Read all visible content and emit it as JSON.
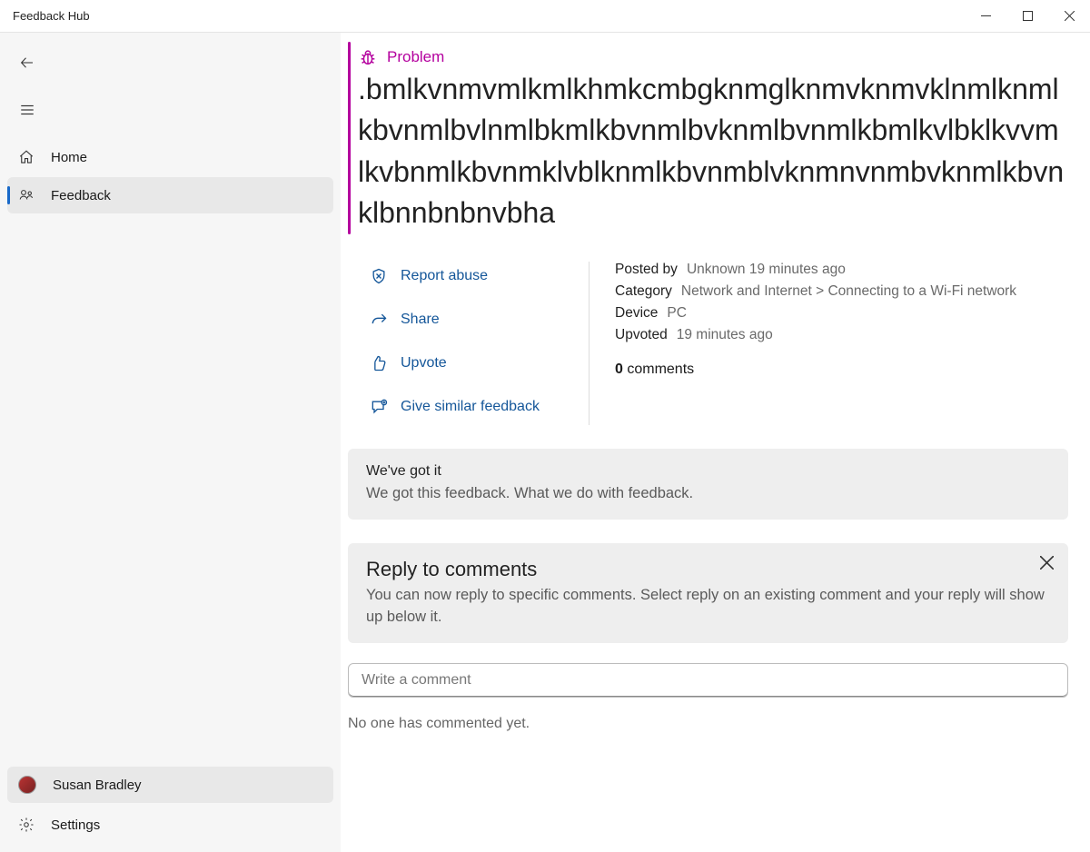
{
  "window": {
    "title": "Feedback Hub"
  },
  "sidebar": {
    "home": "Home",
    "feedback": "Feedback",
    "user": "Susan Bradley",
    "settings": "Settings"
  },
  "feedback": {
    "tag": "Problem",
    "title": ".bmlkvnmvmlkmlkhmkcmbgknmglknmvknmvklnmlknmlkbvnmlbvlnmlbkmlkbvnmlbvknmlbvnmlkbmlkvlbklkvvmlkvbnmlkbvnmklvblknmlkbvnmblvknmnvnmbvknmlkbvnklbnnbnbnvbha"
  },
  "actions": {
    "report_abuse": "Report abuse",
    "share": "Share",
    "upvote": "Upvote",
    "similar": "Give similar feedback"
  },
  "meta": {
    "posted_label": "Posted by",
    "posted_value": "Unknown 19 minutes ago",
    "category_label": "Category",
    "category_value": "Network and Internet  >  Connecting to a Wi-Fi network",
    "device_label": "Device",
    "device_value": "PC",
    "upvoted_label": "Upvoted",
    "upvoted_value": "19 minutes ago",
    "comments_count": "0",
    "comments_word": " comments"
  },
  "status_card": {
    "title": "We've got it",
    "body": "We got this feedback. What we do with feedback."
  },
  "reply_card": {
    "title": "Reply to comments",
    "body": "You can now reply to specific comments. Select reply on an existing comment and your reply will show up below it."
  },
  "comment_box": {
    "placeholder": "Write a comment"
  },
  "empty_state": "No one has commented yet."
}
